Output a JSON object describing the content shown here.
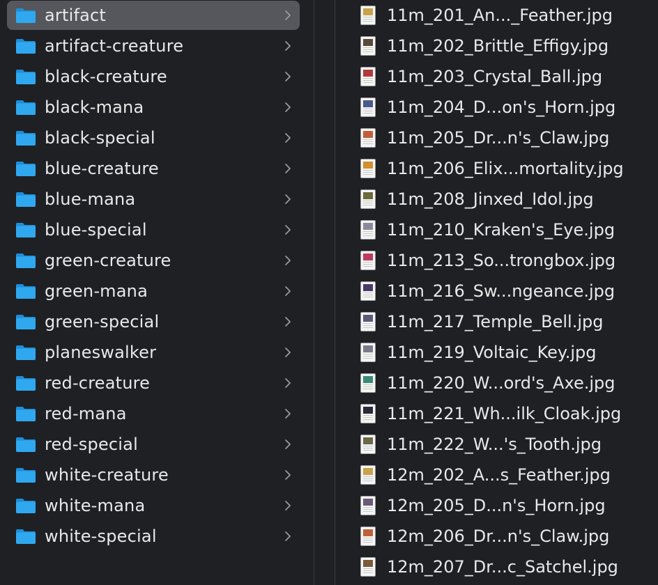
{
  "folders": [
    {
      "label": "artifact",
      "selected": true
    },
    {
      "label": "artifact-creature"
    },
    {
      "label": "black-creature"
    },
    {
      "label": "black-mana"
    },
    {
      "label": "black-special"
    },
    {
      "label": "blue-creature"
    },
    {
      "label": "blue-mana"
    },
    {
      "label": "blue-special"
    },
    {
      "label": "green-creature"
    },
    {
      "label": "green-mana"
    },
    {
      "label": "green-special"
    },
    {
      "label": "planeswalker"
    },
    {
      "label": "red-creature"
    },
    {
      "label": "red-mana"
    },
    {
      "label": "red-special"
    },
    {
      "label": "white-creature"
    },
    {
      "label": "white-mana"
    },
    {
      "label": "white-special"
    }
  ],
  "files": [
    {
      "label": "11m_201_An..._Feather.jpg",
      "art_color": "#c9a24a"
    },
    {
      "label": "11m_202_Brittle_Effigy.jpg",
      "art_color": "#5a4a3a"
    },
    {
      "label": "11m_203_Crystal_Ball.jpg",
      "art_color": "#b03a3a"
    },
    {
      "label": "11m_204_D...on's_Horn.jpg",
      "art_color": "#4a5a8a"
    },
    {
      "label": "11m_205_Dr...n's_Claw.jpg",
      "art_color": "#c0603a"
    },
    {
      "label": "11m_206_Elix...mortality.jpg",
      "art_color": "#d0902a"
    },
    {
      "label": "11m_208_Jinxed_Idol.jpg",
      "art_color": "#6a6a3a"
    },
    {
      "label": "11m_210_Kraken's_Eye.jpg",
      "art_color": "#8a8a9a"
    },
    {
      "label": "11m_213_So...trongbox.jpg",
      "art_color": "#c03a5a"
    },
    {
      "label": "11m_216_Sw...ngeance.jpg",
      "art_color": "#4a3a6a"
    },
    {
      "label": "11m_217_Temple_Bell.jpg",
      "art_color": "#5a5a7a"
    },
    {
      "label": "11m_219_Voltaic_Key.jpg",
      "art_color": "#7a7a8a"
    },
    {
      "label": "11m_220_W...ord's_Axe.jpg",
      "art_color": "#3a8a7a"
    },
    {
      "label": "11m_221_Wh...ilk_Cloak.jpg",
      "art_color": "#2a2a3a"
    },
    {
      "label": "11m_222_W...'s_Tooth.jpg",
      "art_color": "#6a6a4a"
    },
    {
      "label": "12m_202_A...s_Feather.jpg",
      "art_color": "#c9a24a"
    },
    {
      "label": "12m_205_D...n's_Horn.jpg",
      "art_color": "#6a5a7a"
    },
    {
      "label": "12m_206_Dr...n's_Claw.jpg",
      "art_color": "#c0603a"
    },
    {
      "label": "12m_207_Dr...c_Satchel.jpg",
      "art_color": "#7a5a3a"
    }
  ],
  "colors": {
    "folder_blue": "#2fa8f0",
    "folder_blue_dark": "#1e8ed8",
    "selection": "#56575c",
    "background": "#1f2024",
    "chevron": "#9a9a9e"
  },
  "icons": {
    "folder": "folder-icon",
    "chevron": "chevron-right-icon",
    "file_thumbnail": "image-file-icon"
  }
}
